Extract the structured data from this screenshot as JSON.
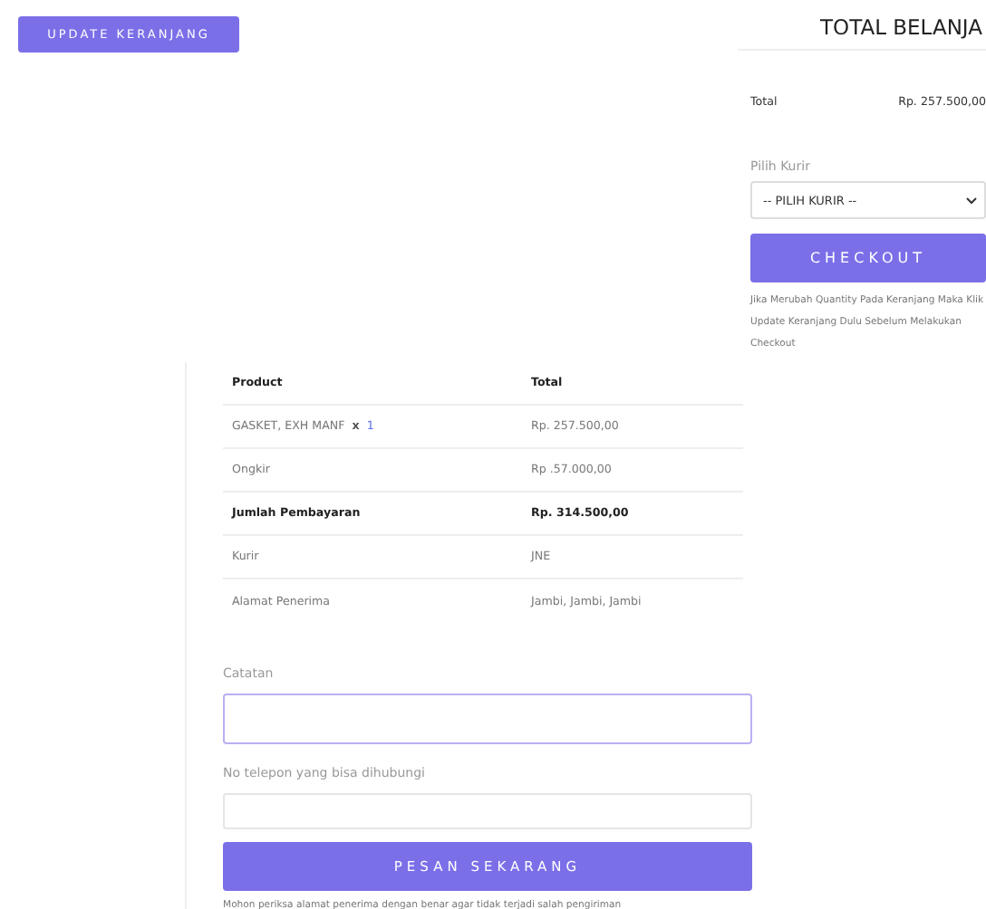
{
  "update_button": "UPDATE KERANJANG",
  "summary": {
    "title": "TOTAL BELANJA",
    "total_label": "Total",
    "total_value": "Rp. 257.500,00",
    "courier_label": "Pilih Kurir",
    "courier_select": "-- PILIH KURIR --",
    "checkout_button": "CHECKOUT",
    "note": "Jika Merubah Quantity Pada Keranjang Maka Klik Update Keranjang Dulu Sebelum Melakukan Checkout"
  },
  "order": {
    "columns": [
      "Product",
      "Total"
    ],
    "rows": [
      {
        "kind": "item",
        "label": "GASKET, EXH MANF",
        "multiplier": "x",
        "quantity": "1",
        "value": "Rp. 257.500,00"
      },
      {
        "kind": "plain",
        "label": "Ongkir",
        "value": "Rp .57.000,00"
      },
      {
        "kind": "total",
        "label": "Jumlah Pembayaran",
        "value": "Rp. 314.500,00"
      },
      {
        "kind": "plain",
        "label": "Kurir",
        "value": "JNE"
      },
      {
        "kind": "plain",
        "label": "Alamat Penerima",
        "value": "Jambi, Jambi, Jambi"
      }
    ],
    "notes_label": "Catatan",
    "phone_label": "No telepon yang bisa dihubungi",
    "order_button": "PESAN SEKARANG",
    "footer_note": "Mohon periksa alamat penerima dengan benar agar tidak terjadi salah pengiriman"
  }
}
